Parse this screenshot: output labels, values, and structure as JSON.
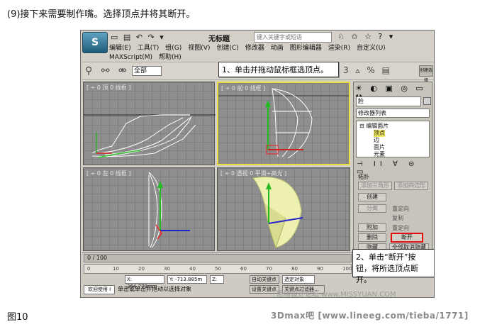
{
  "captions": {
    "top": "(9)接下来需要制作嘴。选择顶点并将其断开。",
    "bottom": "图10",
    "credit": "3Dmax吧 [www.lineeg.com/tieba/1771]",
    "watermark": "思缘设计论坛 www.MISSYUAN.COM"
  },
  "app": {
    "logo": "S",
    "title": "无标题",
    "search_placeholder": "键入关键字或短语",
    "quick_access": "▭ ▤ ↶ ↷ ▾",
    "title_icons": "♘ ✩ ☆ ? ▾",
    "menu": [
      "编辑(E)",
      "工具(T)",
      "组(G)",
      "视图(V)",
      "创建(C)",
      "修改器",
      "动画",
      "图形编辑器",
      "渲染(R)",
      "自定义(U)",
      "MAXScript(M)",
      "帮助(H)"
    ],
    "toolbar": {
      "icons": "⚲ ⚯ ⚮",
      "selection_filter": "全部",
      "right_icons": "3 ▵ % ▤",
      "right_button": "创建选择"
    }
  },
  "callouts": {
    "one": "1、单击并拖动鼠标框选顶点。",
    "two": "2、单击“断开”按钮，将所选顶点断开。"
  },
  "viewports": [
    {
      "label": "[ + 0 顶 0 线框 ]",
      "active": false
    },
    {
      "label": "[ + 0 前 0 线框 ]",
      "active": true
    },
    {
      "label": "[ + 0 左 0 线框 ]",
      "active": false
    },
    {
      "label": "[ + 0 透视 0 平滑+高光 ]",
      "active": false
    }
  ],
  "command_panel": {
    "tabs": "☀ ◐ ▣ ◎ ▭ ⚒",
    "object_name": "脸",
    "modifier_list": "修改器列表",
    "stack": [
      {
        "label": "⊟ 编辑面片",
        "selected": false
      },
      {
        "label": "顶点",
        "selected": true
      },
      {
        "label": "边",
        "selected": false
      },
      {
        "label": "面片",
        "selected": false
      },
      {
        "label": "元素",
        "selected": false
      }
    ],
    "stack_icons": "⊣ ⅠⅠ ∀ ⊝ ▭",
    "rollout_title": "拓扑",
    "buttons": {
      "add_tri": "添加三角形",
      "add_quad": "添加四边形",
      "create": "创建",
      "detach": "分离",
      "attach": "附加",
      "delete": "删除",
      "break": "断开",
      "hide": "隐藏",
      "unhide_all": "全部取消隐藏"
    },
    "checks": {
      "reorient1": "重定向",
      "copy": "复制",
      "reorient2": "重定向"
    }
  },
  "bottom_bar": {
    "frame": "0 / 100",
    "ruler_ticks": [
      "0",
      "10",
      "20",
      "30",
      "40",
      "50",
      "60",
      "70",
      "80",
      "90",
      "100"
    ],
    "welcome": "欢迎使用 I",
    "prompt": "单击或单击并拖动以选择对象",
    "x": "X: 364.779mm",
    "y": "Y: -713.885m",
    "z": "Z:",
    "auto_key": "自动关键点",
    "set_key": "设置关键点",
    "key_mode": "选定对象",
    "key_filters": "关键点过滤器..."
  }
}
